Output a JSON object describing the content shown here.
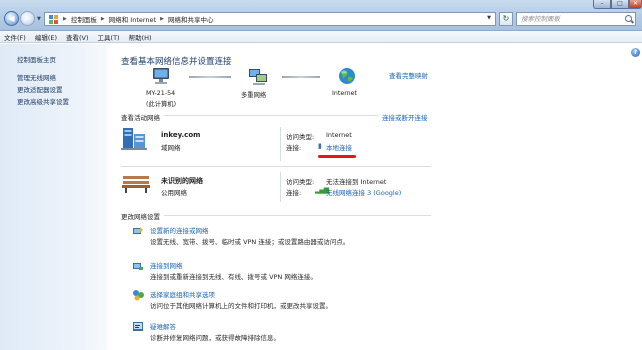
{
  "window": {
    "breadcrumbs": [
      "控制面板",
      "网络和 Internet",
      "网络和共享中心"
    ],
    "search_placeholder": "搜索控制面板",
    "controls": {
      "minimize": "–",
      "maximize": "□",
      "close": "✕"
    }
  },
  "menu": [
    "文件(F)",
    "编辑(E)",
    "查看(V)",
    "工具(T)",
    "帮助(H)"
  ],
  "sidebar": {
    "items": [
      {
        "label": "控制面板主页"
      },
      {
        "label": "管理无线网络"
      },
      {
        "label": "更改适配器设置"
      },
      {
        "label": "更改高级共享设置"
      }
    ]
  },
  "main": {
    "title": "查看基本网络信息并设置连接",
    "full_map_link": "查看完整映射",
    "map": {
      "computer_name": "MY-21-54",
      "computer_sub": "(此计算机)",
      "multi_network": "多重网络",
      "internet": "Internet"
    },
    "active_label": "查看活动网络",
    "connect_disconnect_link": "连接或断开连接",
    "networks": [
      {
        "name": "inkey.com",
        "type": "域网络",
        "access_label": "访问类型:",
        "access_value": "Internet",
        "conn_label": "连接:",
        "conn_value": "本地连接"
      },
      {
        "name": "未识别的网络",
        "type": "公用网络",
        "access_label": "访问类型:",
        "access_value": "无法连接到 Internet",
        "conn_label": "连接:",
        "conn_value": "无线网络连接 3 (Google)"
      }
    ],
    "change_label": "更改网络设置",
    "tasks": [
      {
        "title": "设置新的连接或网络",
        "desc": "设置无线、宽带、拨号、临时或 VPN 连接；或设置路由器或访问点。"
      },
      {
        "title": "连接到网络",
        "desc": "连接到或重新连接到无线、有线、拨号或 VPN 网络连接。"
      },
      {
        "title": "选择家庭组和共享选项",
        "desc": "访问位于其他网络计算机上的文件和打印机，或更改共享设置。"
      },
      {
        "title": "疑难解答",
        "desc": "诊断并修复网络问题，或获得故障排除信息。"
      }
    ]
  },
  "help_glyph": "?",
  "colors": {
    "link": "#1a62b2",
    "title": "#1e3f73",
    "highlight": "#e01818"
  }
}
